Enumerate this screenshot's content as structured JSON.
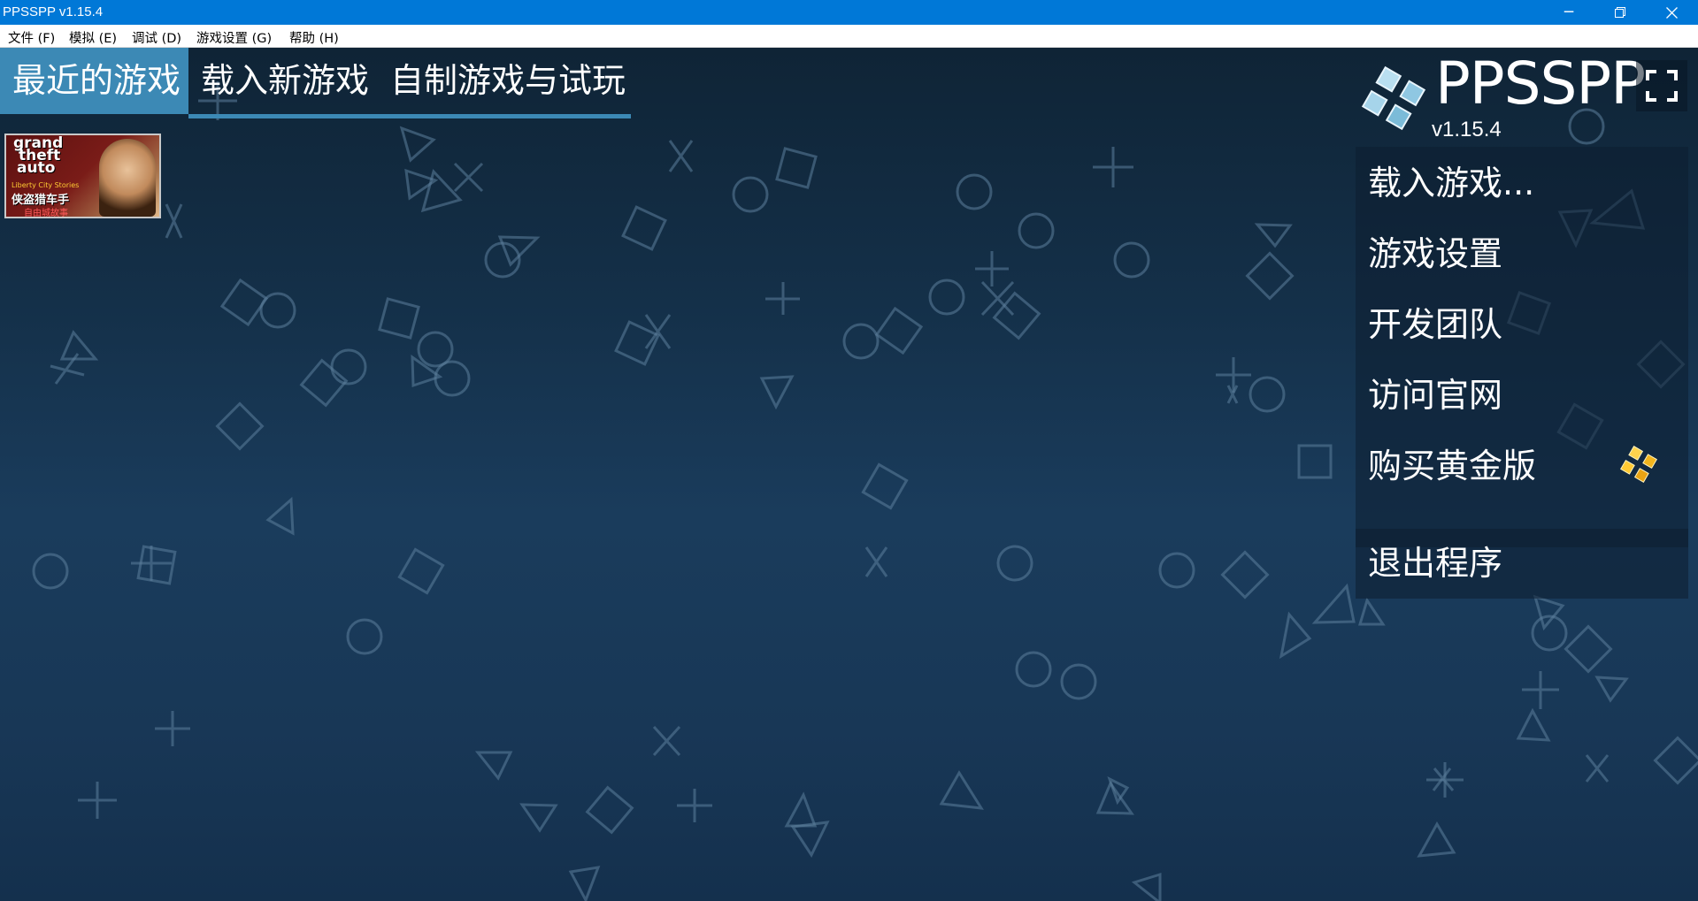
{
  "window": {
    "title": "PPSSPP v1.15.4"
  },
  "menubar": {
    "items": [
      "文件 (F)",
      "模拟 (E)",
      "调试 (D)",
      "游戏设置 (G)",
      "帮助 (H)"
    ]
  },
  "tabs": [
    "最近的游戏",
    "载入新游戏",
    "自制游戏与试玩"
  ],
  "recent_games": [
    {
      "title_lines": [
        "grand",
        "theft",
        "auto"
      ],
      "subtitle_en": "Liberty City Stories",
      "subtitle_cn": "侠盗猎车手",
      "subtitle_cn2": "自由城故事"
    }
  ],
  "logo": {
    "text": "PPSSPP",
    "version": "v1.15.4"
  },
  "main_menu": [
    "载入游戏...",
    "游戏设置",
    "开发团队",
    "访问官网",
    "购买黄金版"
  ],
  "exit_label": "退出程序",
  "colors": {
    "titlebar": "#0078d7",
    "tab_active": "#3c89b5",
    "background": "#163550"
  },
  "icons": [
    "minimize-icon",
    "restore-icon",
    "close-icon",
    "ppsspp-logo-icon",
    "fullscreen-icon",
    "gold-logo-icon"
  ]
}
